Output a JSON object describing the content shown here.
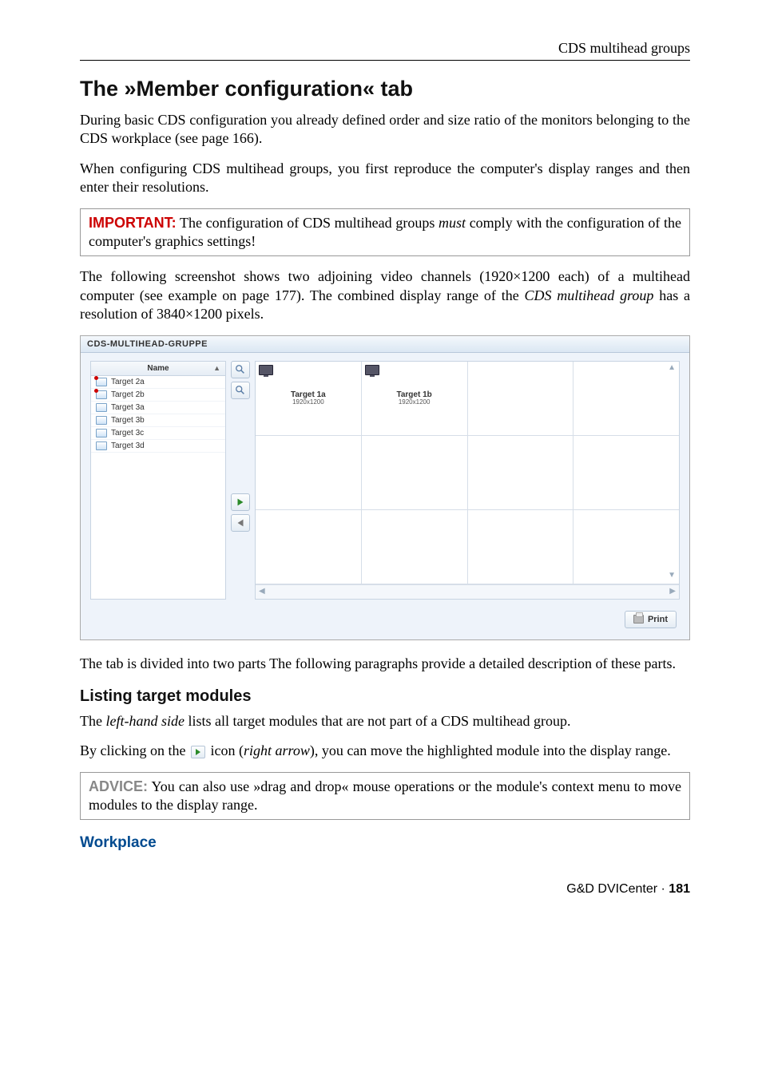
{
  "header": {
    "section": "CDS multihead groups"
  },
  "h1": "The »Member configuration« tab",
  "p1a": "During basic CDS configuration you already defined order and size ratio of the monitors belonging to the CDS workplace (see page 166).",
  "p1b": "When configuring CDS multihead groups, you first reproduce the computer's display ranges and then enter their resolutions.",
  "important": {
    "label": "IMPORTANT:",
    "text_before": " The configuration of CDS multihead groups ",
    "text_em": "must",
    "text_after": " comply with the configuration of the computer's graphics settings!"
  },
  "p2a": "The following screenshot shows two adjoining video channels (1920×1200 each) of a multihead computer (see example on page 177). The combined display range of the ",
  "p2b": "CDS multihead group",
  "p2c": " has a resolution of 3840×1200 pixels.",
  "panel": {
    "title": "CDS-MULTIHEAD-GRUPPE",
    "list_header": "Name",
    "sort_indicator": "▲",
    "targets": [
      {
        "name": "Target 2a",
        "badge": true
      },
      {
        "name": "Target 2b",
        "badge": true
      },
      {
        "name": "Target 3a",
        "badge": false
      },
      {
        "name": "Target 3b",
        "badge": false
      },
      {
        "name": "Target 3c",
        "badge": false
      },
      {
        "name": "Target 3d",
        "badge": false
      }
    ],
    "cells": [
      {
        "title": "Target 1a",
        "res": "1920x1200"
      },
      {
        "title": "Target 1b",
        "res": "1920x1200"
      }
    ],
    "print_label": "Print"
  },
  "p3": "The tab is divided into two parts The following paragraphs provide a detailed description of these parts.",
  "h2a": "Listing target modules",
  "p4a": "The ",
  "p4b": "left-hand side",
  "p4c": " lists all target modules that are not part of a CDS multihead group.",
  "p5a": "By clicking on the ",
  "p5b": " icon (",
  "p5c": "right arrow",
  "p5d": "), you can move the highlighted module into the display range.",
  "advice": {
    "label": "ADVICE:",
    "text": " You can also use »drag and drop« mouse operations or the module's context menu to move modules to the display range."
  },
  "h3": "Workplace",
  "footer": {
    "product": "G&D DVICenter · ",
    "page": "181"
  }
}
